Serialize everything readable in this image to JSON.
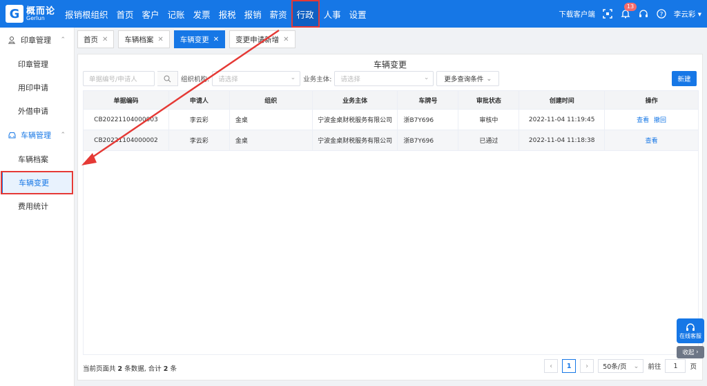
{
  "brand": {
    "name_cn": "概而论",
    "name_en": "Gerlun"
  },
  "nav": {
    "items": [
      {
        "label": "报销根组织"
      },
      {
        "label": "首页"
      },
      {
        "label": "客户"
      },
      {
        "label": "记账"
      },
      {
        "label": "发票"
      },
      {
        "label": "报税"
      },
      {
        "label": "报销"
      },
      {
        "label": "薪资"
      },
      {
        "label": "行政"
      },
      {
        "label": "人事"
      },
      {
        "label": "设置"
      }
    ],
    "active": "行政"
  },
  "topright": {
    "download": "下载客户端",
    "notif_count": "13",
    "user": "李云彩"
  },
  "sidebar": {
    "group1": "印章管理",
    "items1": [
      "印章管理",
      "用印申请",
      "外借申请"
    ],
    "group2": "车辆管理",
    "items2": [
      "车辆档案",
      "车辆变更",
      "费用统计"
    ]
  },
  "tabs": [
    {
      "label": "首页"
    },
    {
      "label": "车辆档案"
    },
    {
      "label": "车辆变更"
    },
    {
      "label": "变更申请新增"
    }
  ],
  "page": {
    "title": "车辆变更",
    "search_placeholder": "单据编号/申请人",
    "org_label": "组织机构:",
    "org_placeholder": "请选择",
    "biz_label": "业务主体:",
    "biz_placeholder": "请选择",
    "more_filters": "更多查询条件",
    "new_button": "新建"
  },
  "table": {
    "columns": [
      "单据编码",
      "申请人",
      "组织",
      "业务主体",
      "车牌号",
      "审批状态",
      "创建时间",
      "操作"
    ],
    "rows": [
      {
        "code": "CB20221104000003",
        "applicant": "李云彩",
        "org": "金桌",
        "entity": "宁波金桌财税服务有限公司",
        "plate": "浙B7Y696",
        "status": "审核中",
        "created": "2022-11-04 11:19:45",
        "actions": [
          "查看",
          "撤回"
        ]
      },
      {
        "code": "CB20221104000002",
        "applicant": "李云彩",
        "org": "金桌",
        "entity": "宁波金桌财税服务有限公司",
        "plate": "浙B7Y696",
        "status": "已通过",
        "created": "2022-11-04 11:18:38",
        "actions": [
          "查看"
        ]
      }
    ]
  },
  "footer": {
    "prefix": "当前页面共",
    "count": "2",
    "mid": "条数据, 合计",
    "total": "2",
    "suffix": "条",
    "page": "1",
    "page_size": "50条/页",
    "goto_label": "前往",
    "goto_value": "1",
    "page_suffix": "页"
  },
  "service": {
    "label": "在线客服",
    "collapse": "收起"
  },
  "colors": {
    "primary": "#1677e6",
    "highlight": "#e53935"
  }
}
